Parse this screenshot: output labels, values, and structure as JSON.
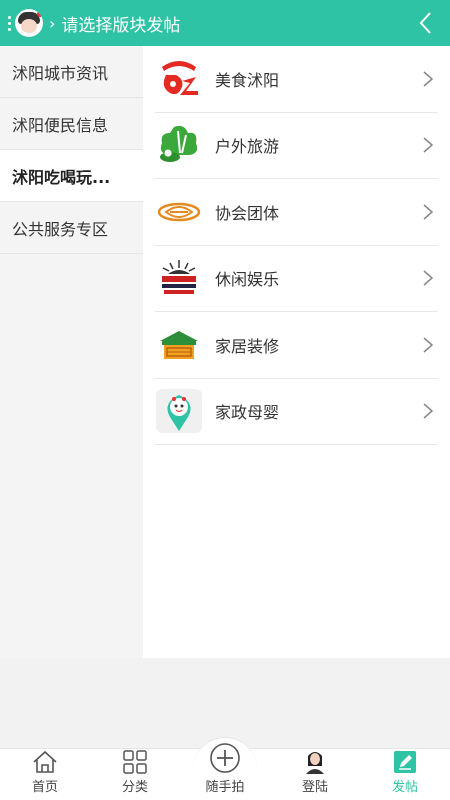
{
  "header": {
    "title": "请选择版块发帖"
  },
  "sidebar": {
    "items": [
      {
        "label": "沭阳城市资讯"
      },
      {
        "label": "沭阳便民信息"
      },
      {
        "label": "沭阳吃喝玩..."
      },
      {
        "label": "公共服务专区"
      }
    ],
    "active_index": 2
  },
  "list": {
    "items": [
      {
        "label": "美食沭阳",
        "icon": "food-icon"
      },
      {
        "label": "户外旅游",
        "icon": "outdoor-icon"
      },
      {
        "label": "协会团体",
        "icon": "association-icon"
      },
      {
        "label": "休闲娱乐",
        "icon": "leisure-icon"
      },
      {
        "label": "家居装修",
        "icon": "home-decor-icon"
      },
      {
        "label": "家政母婴",
        "icon": "housekeeping-icon"
      }
    ]
  },
  "tabbar": {
    "items": [
      {
        "label": "首页",
        "icon": "home-icon"
      },
      {
        "label": "分类",
        "icon": "grid-icon"
      },
      {
        "label": "随手拍",
        "icon": "plus-circle-icon"
      },
      {
        "label": "登陆",
        "icon": "user-avatar-icon"
      },
      {
        "label": "发帖",
        "icon": "edit-icon"
      }
    ],
    "active_index": 4
  },
  "colors": {
    "accent": "#2ec3a4",
    "food_red": "#e42a22",
    "outdoor_green": "#3aa83a",
    "orange": "#e58a1e"
  }
}
